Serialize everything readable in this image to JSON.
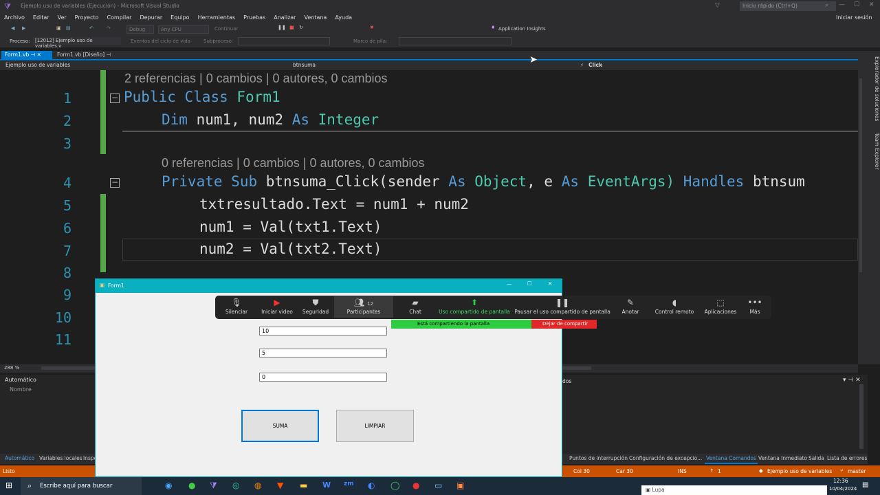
{
  "app": {
    "title": "Ejemplo uso de variables (Ejecución) - Microsoft Visual Studio",
    "quick_launch": "Inicio rápido (Ctrl+Q)",
    "signin": "Iniciar sesión"
  },
  "menu": [
    "Archivo",
    "Editar",
    "Ver",
    "Proyecto",
    "Compilar",
    "Depurar",
    "Equipo",
    "Herramientas",
    "Pruebas",
    "Analizar",
    "Ventana",
    "Ayuda"
  ],
  "toolbar": {
    "config": "Debug",
    "platform": "Any CPU",
    "continue": "Continuar",
    "insights": "Application Insights"
  },
  "procbar": {
    "label": "Proceso:",
    "process": "[12012] Ejemplo uso de variables.v",
    "events": "Eventos del ciclo de vida",
    "subprocess": "Subproceso:",
    "stack": "Marco de pila:"
  },
  "tabs": [
    {
      "label": "Form1.vb"
    },
    {
      "label": "Form1.vb [Diseño]"
    }
  ],
  "nav": {
    "project": "Ejemplo uso de variables",
    "object": "btnsuma",
    "event": "Click"
  },
  "side": {
    "solution": "Explorador de soluciones",
    "team": "Team Explorer"
  },
  "editor": {
    "lens1": "2 referencias | 0 cambios | 0 autores, 0 cambios",
    "lens2": "0 referencias | 0 cambios | 0 autores, 0 cambios",
    "line_numbers": [
      "1",
      "2",
      "3",
      "4",
      "5",
      "6",
      "7",
      "8",
      "9",
      "10",
      "11"
    ],
    "l1": {
      "k1": "Public",
      "k2": "Class",
      "t": "Form1"
    },
    "l2": {
      "k1": "Dim",
      "v": "num1, num2",
      "k2": "As",
      "t": "Integer"
    },
    "l4": {
      "k1": "Private",
      "k2": "Sub",
      "n": "btnsuma_Click(sender",
      "k3": "As",
      "t1": "Object",
      ",": ",",
      "e": "e",
      "k4": "As",
      "t2": "EventArgs)",
      "k5": "Handles",
      "h": "btnsum"
    },
    "l5": "txtresultado.Text = num1 + num2",
    "l6": "num1 = Val(txt1.Text)",
    "l7": "num2 = Val(txt2.Text)"
  },
  "hbar": {
    "zoom": "288 %"
  },
  "bottom": {
    "title": "Automático",
    "column": "Nombre",
    "right_title_fragment": "dos"
  },
  "bottomtabs_left": [
    "Automático",
    "Variables locales",
    "Inspe"
  ],
  "bottomtabs_right": [
    "Puntos de interrupción",
    "Configuración de excepcio...",
    "Ventana Comandos",
    "Ventana Inmediato",
    "Salida",
    "Lista de errores"
  ],
  "status": {
    "ready": "Listo",
    "col": "Col 30",
    "car": "Car 30",
    "ins": "INS",
    "up": "1",
    "project": "Ejemplo uso de variables",
    "branch": "master"
  },
  "form": {
    "title": "Form1",
    "txt1": "10",
    "txt2": "5",
    "result": "0",
    "btn_sum": "SUMA",
    "btn_clear": "LIMPIAR"
  },
  "zoom": {
    "items": [
      "Silenciar",
      "Iniciar video",
      "Seguridad",
      "Participantes",
      "Chat",
      "Uso compartido de pantalla",
      "Pausar el uso compartido de pantalla",
      "Anotar",
      "Control remoto",
      "Aplicaciones",
      "Más"
    ],
    "participants_count": "12",
    "sharing": "Está compartiendo la pantalla",
    "stop": "Dejar de compartir"
  },
  "taskbar": {
    "search": "Escribe aquí para buscar",
    "time": "12:36",
    "date": "10/04/2024",
    "lupa": "Lupa"
  },
  "colors": {
    "keyword": "#569cd6",
    "type": "#4ec9b0",
    "accent": "#007acc",
    "status": "#ca5100"
  }
}
